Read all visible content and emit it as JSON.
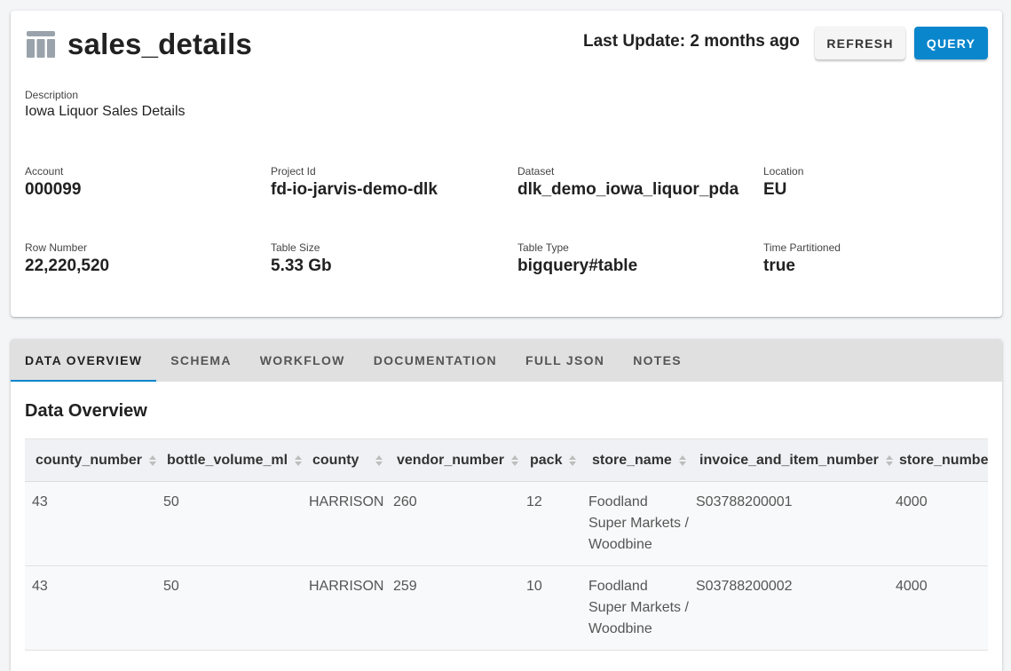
{
  "header": {
    "title": "sales_details",
    "last_update": "Last Update: 2 months ago",
    "refresh_label": "REFRESH",
    "query_label": "QUERY",
    "icon": "table-icon"
  },
  "description": {
    "label": "Description",
    "value": "Iowa Liquor Sales Details"
  },
  "fields": {
    "account": {
      "label": "Account",
      "value": "000099"
    },
    "project_id": {
      "label": "Project Id",
      "value": "fd-io-jarvis-demo-dlk"
    },
    "dataset": {
      "label": "Dataset",
      "value": "dlk_demo_iowa_liquor_pda"
    },
    "location": {
      "label": "Location",
      "value": "EU"
    },
    "row_number": {
      "label": "Row Number",
      "value": "22,220,520"
    },
    "table_size": {
      "label": "Table Size",
      "value": "5.33 Gb"
    },
    "table_type": {
      "label": "Table Type",
      "value": "bigquery#table"
    },
    "time_partitioned": {
      "label": "Time Partitioned",
      "value": "true"
    }
  },
  "tabs": [
    {
      "label": "DATA OVERVIEW",
      "active": true
    },
    {
      "label": "SCHEMA",
      "active": false
    },
    {
      "label": "WORKFLOW",
      "active": false
    },
    {
      "label": "DOCUMENTATION",
      "active": false
    },
    {
      "label": "FULL JSON",
      "active": false
    },
    {
      "label": "NOTES",
      "active": false
    }
  ],
  "overview": {
    "title": "Data Overview",
    "columns": [
      "county_number",
      "bottle_volume_ml",
      "county",
      "vendor_number",
      "pack",
      "store_name",
      "invoice_and_item_number",
      "store_number"
    ],
    "rows": [
      [
        "43",
        "50",
        "HARRISON",
        "260",
        "12",
        "Foodland Super Markets / Woodbine",
        "S03788200001",
        "4000"
      ],
      [
        "43",
        "50",
        "HARRISON",
        "259",
        "10",
        "Foodland Super Markets / Woodbine",
        "S03788200002",
        "4000"
      ]
    ]
  },
  "colors": {
    "accent": "#0a86cd",
    "tab_bar": "#e0e0e0",
    "page_bg": "#f4f5f7"
  }
}
